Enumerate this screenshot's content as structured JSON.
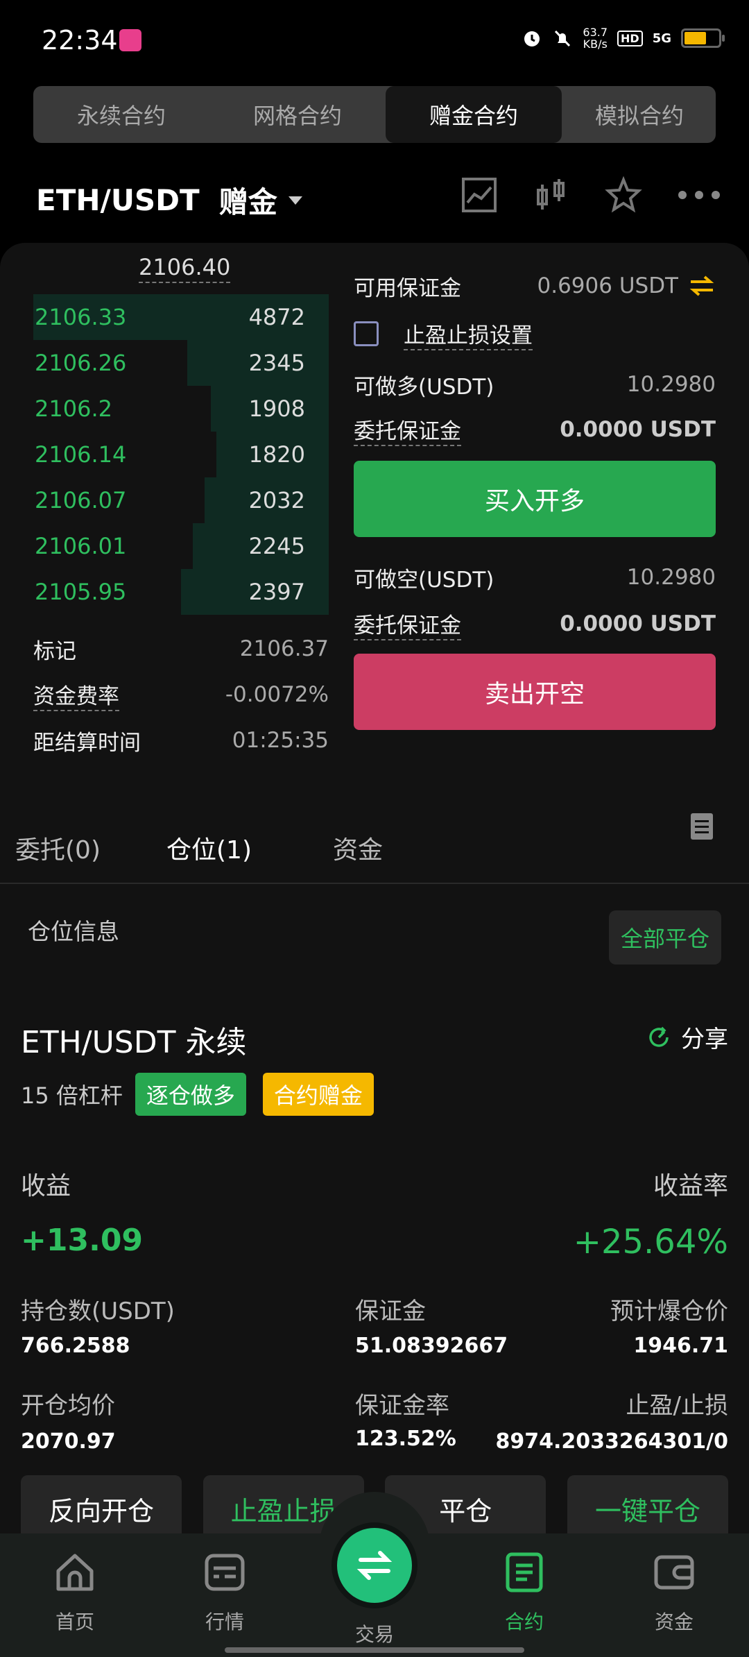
{
  "status": {
    "time": "22:34",
    "net_speed": "63.7",
    "net_unit": "KB/s",
    "hd": "HD",
    "signal": "5G"
  },
  "top_tabs": [
    {
      "label": "永续合约"
    },
    {
      "label": "网格合约"
    },
    {
      "label": "赠金合约",
      "active": true
    },
    {
      "label": "模拟合约"
    }
  ],
  "header": {
    "pair": "ETH/USDT",
    "mode": "赠金"
  },
  "orderbook": {
    "last_price": "2106.40",
    "rows": [
      {
        "price": "2106.33",
        "qty": "4872",
        "depth": 1.0
      },
      {
        "price": "2106.26",
        "qty": "2345",
        "depth": 0.48
      },
      {
        "price": "2106.2",
        "qty": "1908",
        "depth": 0.4
      },
      {
        "price": "2106.14",
        "qty": "1820",
        "depth": 0.38
      },
      {
        "price": "2106.07",
        "qty": "2032",
        "depth": 0.42
      },
      {
        "price": "2106.01",
        "qty": "2245",
        "depth": 0.46
      },
      {
        "price": "2105.95",
        "qty": "2397",
        "depth": 0.5
      }
    ]
  },
  "stats": {
    "mark_label": "标记",
    "mark_value": "2106.37",
    "funding_label": "资金费率",
    "funding_value": "-0.0072%",
    "settle_label": "距结算时间",
    "settle_value": "01:25:35"
  },
  "trade": {
    "available_label": "可用保证金",
    "available_value": "0.6906 USDT",
    "tpsl_label": "止盈止损设置",
    "long_label": "可做多(USDT)",
    "long_value": "10.2980",
    "order_margin_label": "委托保证金",
    "order_margin_value": "0.0000 USDT",
    "buy_button": "买入开多",
    "short_label": "可做空(USDT)",
    "short_value": "10.2980",
    "order_margin_label2": "委托保证金",
    "order_margin_value2": "0.0000 USDT",
    "sell_button": "卖出开空"
  },
  "sub_tabs": [
    {
      "label": "委托(0)"
    },
    {
      "label": "仓位(1)",
      "active": true
    },
    {
      "label": "资金"
    }
  ],
  "position": {
    "section_title": "仓位信息",
    "close_all": "全部平仓",
    "title": "ETH/USDT 永续",
    "share": "分享",
    "leverage": "15 倍杠杆",
    "tag_side": "逐仓做多",
    "tag_bonus": "合约赠金",
    "pnl_label": "收益",
    "pnl_rate_label": "收益率",
    "pnl": "+13.09",
    "pnl_rate": "+25.64%",
    "size_label": "持仓数(USDT)",
    "size_value": "766.2588",
    "margin_label": "保证金",
    "margin_value": "51.08392667",
    "liq_label": "预计爆仓价",
    "liq_value": "1946.71",
    "entry_label": "开仓均价",
    "entry_value": "2070.97",
    "margin_rate_label": "保证金率",
    "margin_rate_value": "123.52%",
    "tpsl_label": "止盈/止损",
    "tpsl_value": "8974.2033264301/0",
    "actions": [
      "反向开仓",
      "止盈止损",
      "平仓",
      "一键平仓"
    ]
  },
  "nav": [
    {
      "label": "首页",
      "icon": "home-icon"
    },
    {
      "label": "行情",
      "icon": "market-icon"
    },
    {
      "label": "交易",
      "icon": "swap-icon"
    },
    {
      "label": "合约",
      "icon": "contract-icon",
      "active": true
    },
    {
      "label": "资金",
      "icon": "wallet-icon"
    }
  ],
  "colors": {
    "green": "#2fbf5f",
    "red": "#cc3d63",
    "yellow": "#f5b800",
    "bg": "#121212"
  }
}
